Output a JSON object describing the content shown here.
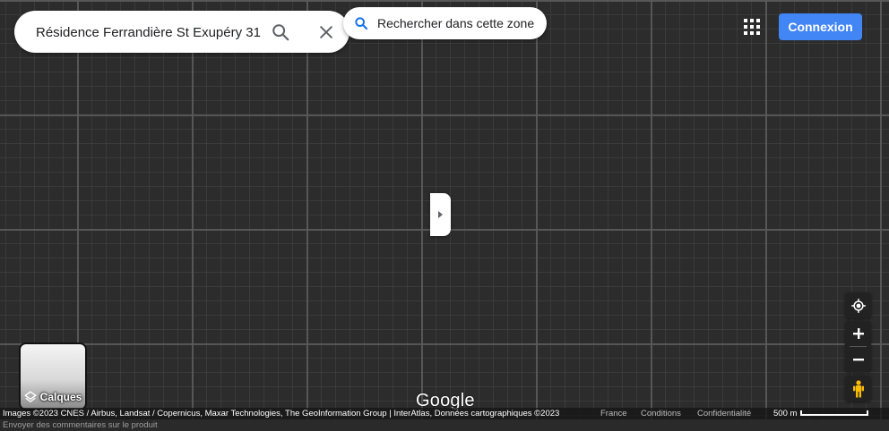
{
  "search": {
    "value": "Résidence Ferrandière St Exupéry 31",
    "search_icon": "search-icon",
    "clear_icon": "close-icon"
  },
  "search_area": {
    "label": "Rechercher dans cette zone",
    "icon": "search-icon"
  },
  "header": {
    "apps_icon": "apps-grid-icon",
    "signin_label": "Connexion",
    "signin_color": "#4285f4"
  },
  "map": {
    "background": "#2c2c2c",
    "side_panel_toggle_icon": "chevron-right-icon"
  },
  "controls": {
    "my_location_icon": "my-location-icon",
    "zoom_in_icon": "plus-icon",
    "zoom_out_icon": "minus-icon",
    "street_view_icon": "pegman-icon",
    "pegman_color": "#fbbc04"
  },
  "layers": {
    "label": "Calques",
    "icon": "layers-icon"
  },
  "logo": "Google",
  "footer": {
    "attribution": "Images ©2023 CNES / Airbus, Landsat / Copernicus, Maxar Technologies, The GeoInformation Group | InterAtlas, Données cartographiques ©2023",
    "links": [
      "France",
      "Conditions",
      "Confidentialité"
    ],
    "scale_label": "500 m",
    "feedback": "Envoyer des commentaires sur le produit"
  }
}
